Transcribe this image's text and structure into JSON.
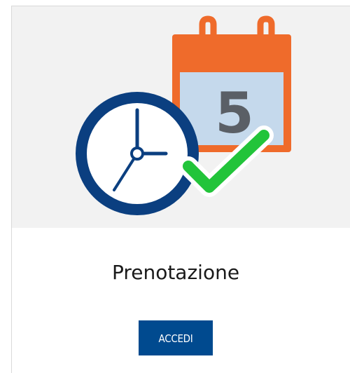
{
  "card": {
    "title": "Prenotazione",
    "button_label": "ACCEDI",
    "calendar_day": "5",
    "icons": [
      "calendar-icon",
      "clock-icon",
      "checkmark-icon"
    ],
    "colors": {
      "image_background": "#f2f2f2",
      "calendar_orange": "#ef6b2b",
      "calendar_page": "#c5d9ec",
      "calendar_number": "#5a5f66",
      "clock_blue": "#0b3f80",
      "check_green": "#22c43a",
      "button_background": "#004a8f",
      "button_text": "#ffffff",
      "border": "#d9d9d9"
    }
  }
}
